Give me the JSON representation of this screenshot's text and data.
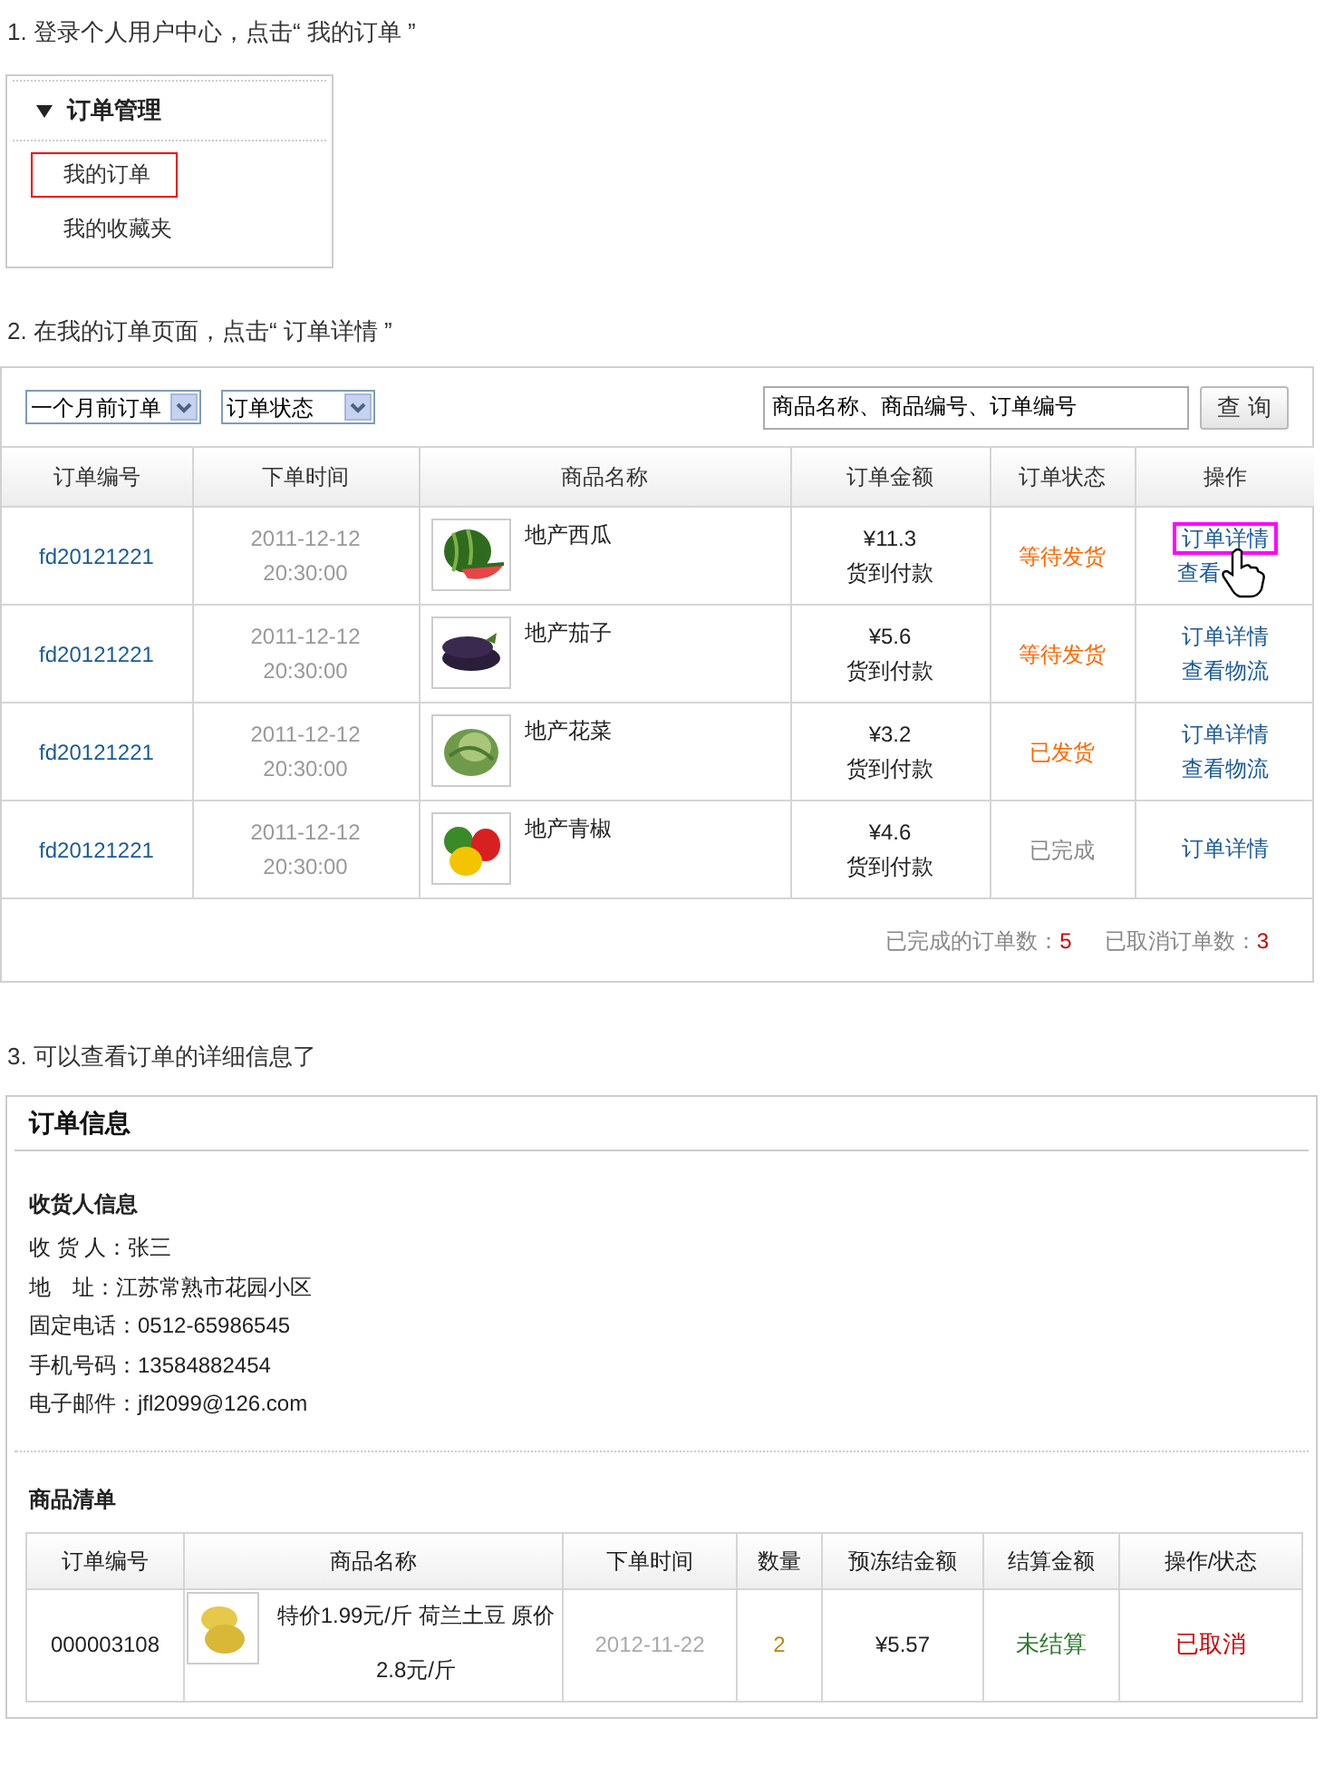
{
  "steps": [
    {
      "text": "1. 登录个人用户中心，点击“ 我的订单 ”"
    },
    {
      "text": "2. 在我的订单页面，点击“ 订单详情 ”"
    },
    {
      "text": "3. 可以查看订单的详细信息了"
    }
  ],
  "menu": {
    "title": "订单管理",
    "expanded": true,
    "items": [
      {
        "label": "我的订单",
        "highlighted": true
      },
      {
        "label": "我的收藏夹",
        "highlighted": false
      }
    ]
  },
  "orders": {
    "filters": [
      {
        "value": "一个月前订单"
      },
      {
        "value": "订单状态"
      }
    ],
    "search": {
      "value": "商品名称、商品编号、订单编号"
    },
    "search_button": "查 询",
    "columns": [
      "订单编号",
      "下单时间",
      "商品名称",
      "订单金额",
      "订单状态",
      "操作"
    ],
    "rows": [
      {
        "id": "fd20121221",
        "date": "2011-12-12",
        "time": "20:30:00",
        "product": "地产西瓜",
        "amount": "¥11.3",
        "payment": "货到付款",
        "status": {
          "text": "等待发货",
          "color": "#ff6600"
        },
        "actions": [
          {
            "label": "订单详情",
            "highlighted": true
          },
          {
            "label": "查看",
            "highlighted": false
          }
        ]
      },
      {
        "id": "fd20121221",
        "date": "2011-12-12",
        "time": "20:30:00",
        "product": "地产茄子",
        "amount": "¥5.6",
        "payment": "货到付款",
        "status": {
          "text": "等待发货",
          "color": "#ff6600"
        },
        "actions": [
          {
            "label": "订单详情",
            "highlighted": false
          },
          {
            "label": "查看物流",
            "highlighted": false
          }
        ]
      },
      {
        "id": "fd20121221",
        "date": "2011-12-12",
        "time": "20:30:00",
        "product": "地产花菜",
        "amount": "¥3.2",
        "payment": "货到付款",
        "status": {
          "text": "已发货",
          "color": "#ff6600"
        },
        "actions": [
          {
            "label": "订单详情",
            "highlighted": false
          },
          {
            "label": "查看物流",
            "highlighted": false
          }
        ]
      },
      {
        "id": "fd20121221",
        "date": "2011-12-12",
        "time": "20:30:00",
        "product": "地产青椒",
        "amount": "¥4.6",
        "payment": "货到付款",
        "status": {
          "text": "已完成",
          "color": "#888888"
        },
        "actions": [
          {
            "label": "订单详情",
            "highlighted": false
          }
        ]
      }
    ],
    "summary": [
      {
        "label": "已完成的订单数：",
        "count": "5"
      },
      {
        "label": "已取消订单数：",
        "count": "3"
      }
    ]
  },
  "order_info": {
    "title": "订单信息",
    "consignee_title": "收货人信息",
    "fields": [
      {
        "label": "收 货 人：",
        "value": "张三"
      },
      {
        "label": "地　址：",
        "value": "江苏常熟市花园小区"
      },
      {
        "label": "固定电话：",
        "value": "0512-65986545"
      },
      {
        "label": "手机号码：",
        "value": "13584882454"
      },
      {
        "label": "电子邮件：",
        "value": "jfl2099@126.com"
      }
    ],
    "goods_title": "商品清单",
    "columns": [
      "订单编号",
      "商品名称",
      "下单时间",
      "数量",
      "预冻结金额",
      "结算金额",
      "操作/状态"
    ],
    "rows": [
      {
        "id": "000003108",
        "name": "特价1.99元/斤 荷兰土豆 原价2.8元/斤",
        "date": "2012-11-22",
        "quantity": "2",
        "frozen": "¥5.57",
        "settled": "未结算",
        "state": "已取消"
      }
    ]
  }
}
